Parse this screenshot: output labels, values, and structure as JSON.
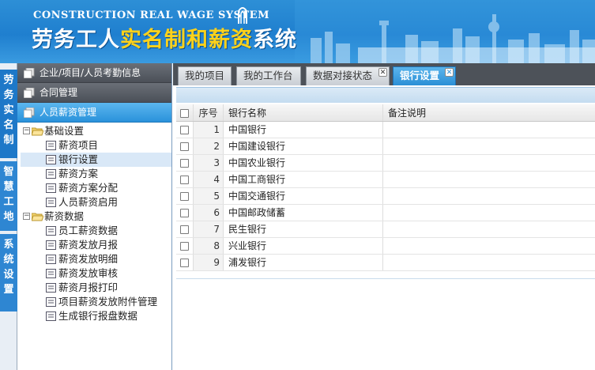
{
  "header": {
    "en_title": "CONSTRUCTION REAL WAGE SYSTEM",
    "cn_title_white_1": "劳务工人",
    "cn_title_yellow": "实名制和薪资",
    "cn_title_white_2": "系统"
  },
  "vertical_tabs": [
    {
      "label": "劳务实名制"
    },
    {
      "label": "智慧工地"
    },
    {
      "label": "系统设置"
    }
  ],
  "accordion": [
    {
      "label": "企业/项目/人员考勤信息"
    },
    {
      "label": "合同管理"
    },
    {
      "label": "人员薪资管理"
    }
  ],
  "tree": {
    "group1": {
      "label": "基础设置",
      "items": [
        "薪资项目",
        "银行设置",
        "薪资方案",
        "薪资方案分配",
        "人员薪资启用"
      ]
    },
    "group2": {
      "label": "薪资数据",
      "items": [
        "员工薪资数据",
        "薪资发放月报",
        "薪资发放明细",
        "薪资发放审核",
        "薪资月报打印",
        "项目薪资发放附件管理",
        "生成银行报盘数据"
      ]
    }
  },
  "tabs": [
    {
      "label": "我的项目"
    },
    {
      "label": "我的工作台"
    },
    {
      "label": "数据对接状态"
    },
    {
      "label": "银行设置"
    }
  ],
  "grid": {
    "columns": {
      "num": "序号",
      "name": "银行名称",
      "note": "备注说明"
    },
    "rows": [
      {
        "num": "1",
        "name": "中国银行",
        "note": ""
      },
      {
        "num": "2",
        "name": "中国建设银行",
        "note": ""
      },
      {
        "num": "3",
        "name": "中国农业银行",
        "note": ""
      },
      {
        "num": "4",
        "name": "中国工商银行",
        "note": ""
      },
      {
        "num": "5",
        "name": "中国交通银行",
        "note": ""
      },
      {
        "num": "6",
        "name": "中国邮政储蓄",
        "note": ""
      },
      {
        "num": "7",
        "name": "民生银行",
        "note": ""
      },
      {
        "num": "8",
        "name": "兴业银行",
        "note": ""
      },
      {
        "num": "9",
        "name": "浦发银行",
        "note": ""
      }
    ]
  },
  "colors": {
    "header_blue": "#1f7fcf",
    "title_yellow": "#ffd21a",
    "accent_blue": "#2b8fd6",
    "dark_bar": "#4d5259"
  }
}
